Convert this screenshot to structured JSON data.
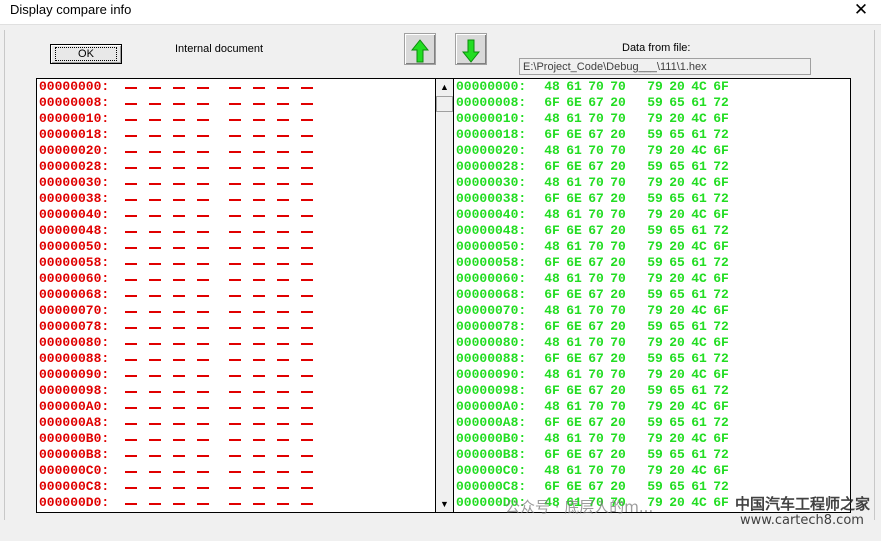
{
  "window": {
    "title": "Display compare info",
    "close_glyph": "✕"
  },
  "toolbar": {
    "ok_label": "OK",
    "internal_label": "Internal document",
    "data_from_file_label": "Data from file:",
    "file_path": "E:\\Project_Code\\Debug___\\111\\1.hex",
    "up_icon": "up-arrow-icon",
    "down_icon": "down-arrow-icon",
    "arrow_color": "#22dd22"
  },
  "left_rows": [
    "00000000:",
    "00000008:",
    "00000010:",
    "00000018:",
    "00000020:",
    "00000028:",
    "00000030:",
    "00000038:",
    "00000040:",
    "00000048:",
    "00000050:",
    "00000058:",
    "00000060:",
    "00000068:",
    "00000070:",
    "00000078:",
    "00000080:",
    "00000088:",
    "00000090:",
    "00000098:",
    "000000A0:",
    "000000A8:",
    "000000B0:",
    "000000B8:",
    "000000C0:",
    "000000C8:",
    "000000D0:"
  ],
  "right_rows": [
    {
      "addr": "00000000:",
      "bytes": [
        "48",
        "61",
        "70",
        "70",
        "79",
        "20",
        "4C",
        "6F"
      ]
    },
    {
      "addr": "00000008:",
      "bytes": [
        "6F",
        "6E",
        "67",
        "20",
        "59",
        "65",
        "61",
        "72"
      ]
    },
    {
      "addr": "00000010:",
      "bytes": [
        "48",
        "61",
        "70",
        "70",
        "79",
        "20",
        "4C",
        "6F"
      ]
    },
    {
      "addr": "00000018:",
      "bytes": [
        "6F",
        "6E",
        "67",
        "20",
        "59",
        "65",
        "61",
        "72"
      ]
    },
    {
      "addr": "00000020:",
      "bytes": [
        "48",
        "61",
        "70",
        "70",
        "79",
        "20",
        "4C",
        "6F"
      ]
    },
    {
      "addr": "00000028:",
      "bytes": [
        "6F",
        "6E",
        "67",
        "20",
        "59",
        "65",
        "61",
        "72"
      ]
    },
    {
      "addr": "00000030:",
      "bytes": [
        "48",
        "61",
        "70",
        "70",
        "79",
        "20",
        "4C",
        "6F"
      ]
    },
    {
      "addr": "00000038:",
      "bytes": [
        "6F",
        "6E",
        "67",
        "20",
        "59",
        "65",
        "61",
        "72"
      ]
    },
    {
      "addr": "00000040:",
      "bytes": [
        "48",
        "61",
        "70",
        "70",
        "79",
        "20",
        "4C",
        "6F"
      ]
    },
    {
      "addr": "00000048:",
      "bytes": [
        "6F",
        "6E",
        "67",
        "20",
        "59",
        "65",
        "61",
        "72"
      ]
    },
    {
      "addr": "00000050:",
      "bytes": [
        "48",
        "61",
        "70",
        "70",
        "79",
        "20",
        "4C",
        "6F"
      ]
    },
    {
      "addr": "00000058:",
      "bytes": [
        "6F",
        "6E",
        "67",
        "20",
        "59",
        "65",
        "61",
        "72"
      ]
    },
    {
      "addr": "00000060:",
      "bytes": [
        "48",
        "61",
        "70",
        "70",
        "79",
        "20",
        "4C",
        "6F"
      ]
    },
    {
      "addr": "00000068:",
      "bytes": [
        "6F",
        "6E",
        "67",
        "20",
        "59",
        "65",
        "61",
        "72"
      ]
    },
    {
      "addr": "00000070:",
      "bytes": [
        "48",
        "61",
        "70",
        "70",
        "79",
        "20",
        "4C",
        "6F"
      ]
    },
    {
      "addr": "00000078:",
      "bytes": [
        "6F",
        "6E",
        "67",
        "20",
        "59",
        "65",
        "61",
        "72"
      ]
    },
    {
      "addr": "00000080:",
      "bytes": [
        "48",
        "61",
        "70",
        "70",
        "79",
        "20",
        "4C",
        "6F"
      ]
    },
    {
      "addr": "00000088:",
      "bytes": [
        "6F",
        "6E",
        "67",
        "20",
        "59",
        "65",
        "61",
        "72"
      ]
    },
    {
      "addr": "00000090:",
      "bytes": [
        "48",
        "61",
        "70",
        "70",
        "79",
        "20",
        "4C",
        "6F"
      ]
    },
    {
      "addr": "00000098:",
      "bytes": [
        "6F",
        "6E",
        "67",
        "20",
        "59",
        "65",
        "61",
        "72"
      ]
    },
    {
      "addr": "000000A0:",
      "bytes": [
        "48",
        "61",
        "70",
        "70",
        "79",
        "20",
        "4C",
        "6F"
      ]
    },
    {
      "addr": "000000A8:",
      "bytes": [
        "6F",
        "6E",
        "67",
        "20",
        "59",
        "65",
        "61",
        "72"
      ]
    },
    {
      "addr": "000000B0:",
      "bytes": [
        "48",
        "61",
        "70",
        "70",
        "79",
        "20",
        "4C",
        "6F"
      ]
    },
    {
      "addr": "000000B8:",
      "bytes": [
        "6F",
        "6E",
        "67",
        "20",
        "59",
        "65",
        "61",
        "72"
      ]
    },
    {
      "addr": "000000C0:",
      "bytes": [
        "48",
        "61",
        "70",
        "70",
        "79",
        "20",
        "4C",
        "6F"
      ]
    },
    {
      "addr": "000000C8:",
      "bytes": [
        "6F",
        "6E",
        "67",
        "20",
        "59",
        "65",
        "61",
        "72"
      ]
    },
    {
      "addr": "000000D0:",
      "bytes": [
        "48",
        "61",
        "70",
        "70",
        "79",
        "20",
        "4C",
        "6F"
      ]
    }
  ],
  "colors": {
    "left_text": "#e00000",
    "right_text": "#22dd22"
  },
  "scrollbar": {
    "up_glyph": "▲",
    "down_glyph": "▼"
  },
  "watermarks": {
    "account": "公众号 · 底层人的m...",
    "brand": "中国汽车工程师之家",
    "site": "www.cartech8.com"
  }
}
